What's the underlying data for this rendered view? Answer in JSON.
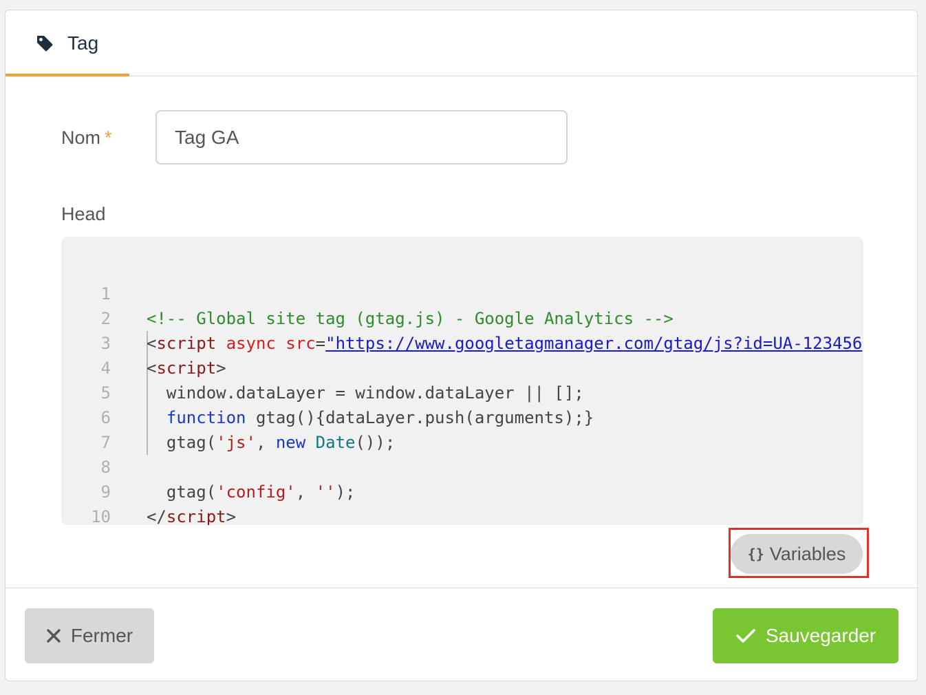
{
  "tab": {
    "label": "Tag",
    "icon": "tag-icon",
    "accent_color": "#f0a23a"
  },
  "form": {
    "name_label": "Nom",
    "required_marker": "*",
    "name_value": "Tag GA",
    "head_label": "Head"
  },
  "code": {
    "lines": [
      {
        "number": "1"
      },
      {
        "number": "2"
      },
      {
        "number": "3"
      },
      {
        "number": "4"
      },
      {
        "number": "5"
      },
      {
        "number": "6"
      },
      {
        "number": "7"
      },
      {
        "number": "8"
      },
      {
        "number": "9"
      },
      {
        "number": "10"
      }
    ],
    "tokens": {
      "l1_comment": "<!-- Global site tag (gtag.js) - Google Analytics -->",
      "l2_open": "<",
      "l2_tag": "script",
      "l2_attr": " async src",
      "l2_eq": "=",
      "l2_quote": "\"",
      "l2_url": "https://www.googletagmanager.com/gtag/js?id=UA-123456",
      "l3_open": "<",
      "l3_tag": "script",
      "l3_close": ">",
      "l4_text": "  window.dataLayer = window.dataLayer || [];",
      "l5_indent": "  ",
      "l5_keyword": "function",
      "l5_rest": " gtag(){dataLayer.push(arguments);}",
      "l6_a": "  gtag(",
      "l6_string": "'js'",
      "l6_b": ", ",
      "l6_keyword": "new",
      "l6_c": " ",
      "l6_builtin": "Date",
      "l6_d": "());",
      "l8_a": "  gtag(",
      "l8_string1": "'config'",
      "l8_b": ", ",
      "l8_string2": "''",
      "l8_c": ");",
      "l9_open": "</",
      "l9_tag": "script",
      "l9_close": ">"
    }
  },
  "variables_button": {
    "label": "Variables",
    "icon": "braces-icon",
    "icon_glyph": "{}",
    "highlight_color": "#e0302a"
  },
  "footer": {
    "close_label": "Fermer",
    "close_icon": "close-icon",
    "save_label": "Sauvegarder",
    "save_icon": "check-icon",
    "save_color": "#7ac532"
  }
}
